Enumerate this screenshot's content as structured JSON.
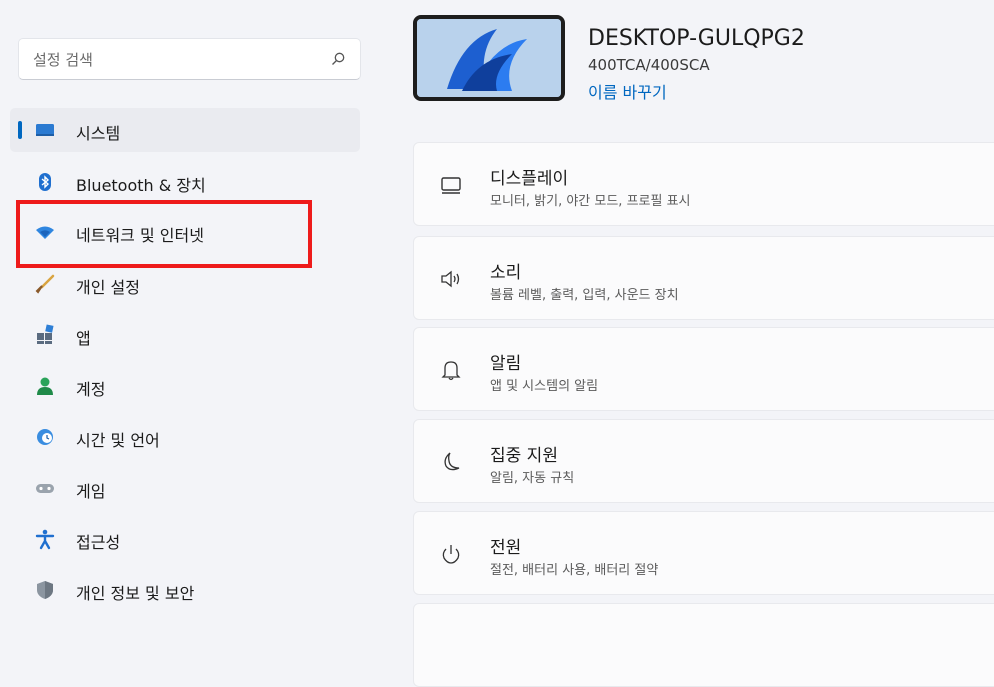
{
  "search": {
    "placeholder": "설정 검색"
  },
  "sidebar": {
    "items": [
      {
        "label": "시스템",
        "icon": "monitor-icon",
        "selected": true
      },
      {
        "label": "Bluetooth & 장치",
        "icon": "bluetooth-icon"
      },
      {
        "label": "네트워크 및 인터넷",
        "icon": "wifi-icon"
      },
      {
        "label": "개인 설정",
        "icon": "brush-icon"
      },
      {
        "label": "앱",
        "icon": "apps-icon"
      },
      {
        "label": "계정",
        "icon": "person-icon"
      },
      {
        "label": "시간 및 언어",
        "icon": "globe-clock-icon"
      },
      {
        "label": "게임",
        "icon": "gamepad-icon"
      },
      {
        "label": "접근성",
        "icon": "accessibility-icon"
      },
      {
        "label": "개인 정보 및 보안",
        "icon": "shield-icon"
      }
    ]
  },
  "device": {
    "name": "DESKTOP-GULQPG2",
    "model": "400TCA/400SCA",
    "rename_label": "이름 바꾸기"
  },
  "cards": [
    {
      "title": "디스플레이",
      "desc": "모니터, 밝기, 야간 모드, 프로필 표시",
      "icon": "display-icon"
    },
    {
      "title": "소리",
      "desc": "볼륨 레벨, 출력, 입력, 사운드 장치",
      "icon": "speaker-icon"
    },
    {
      "title": "알림",
      "desc": "앱 및 시스템의 알림",
      "icon": "bell-icon"
    },
    {
      "title": "집중 지원",
      "desc": "알림, 자동 규칙",
      "icon": "moon-icon"
    },
    {
      "title": "전원",
      "desc": "절전, 배터리 사용, 배터리 절약",
      "icon": "power-icon"
    }
  ],
  "colors": {
    "accent": "#0067c0",
    "highlight": "#ee1b1b"
  }
}
